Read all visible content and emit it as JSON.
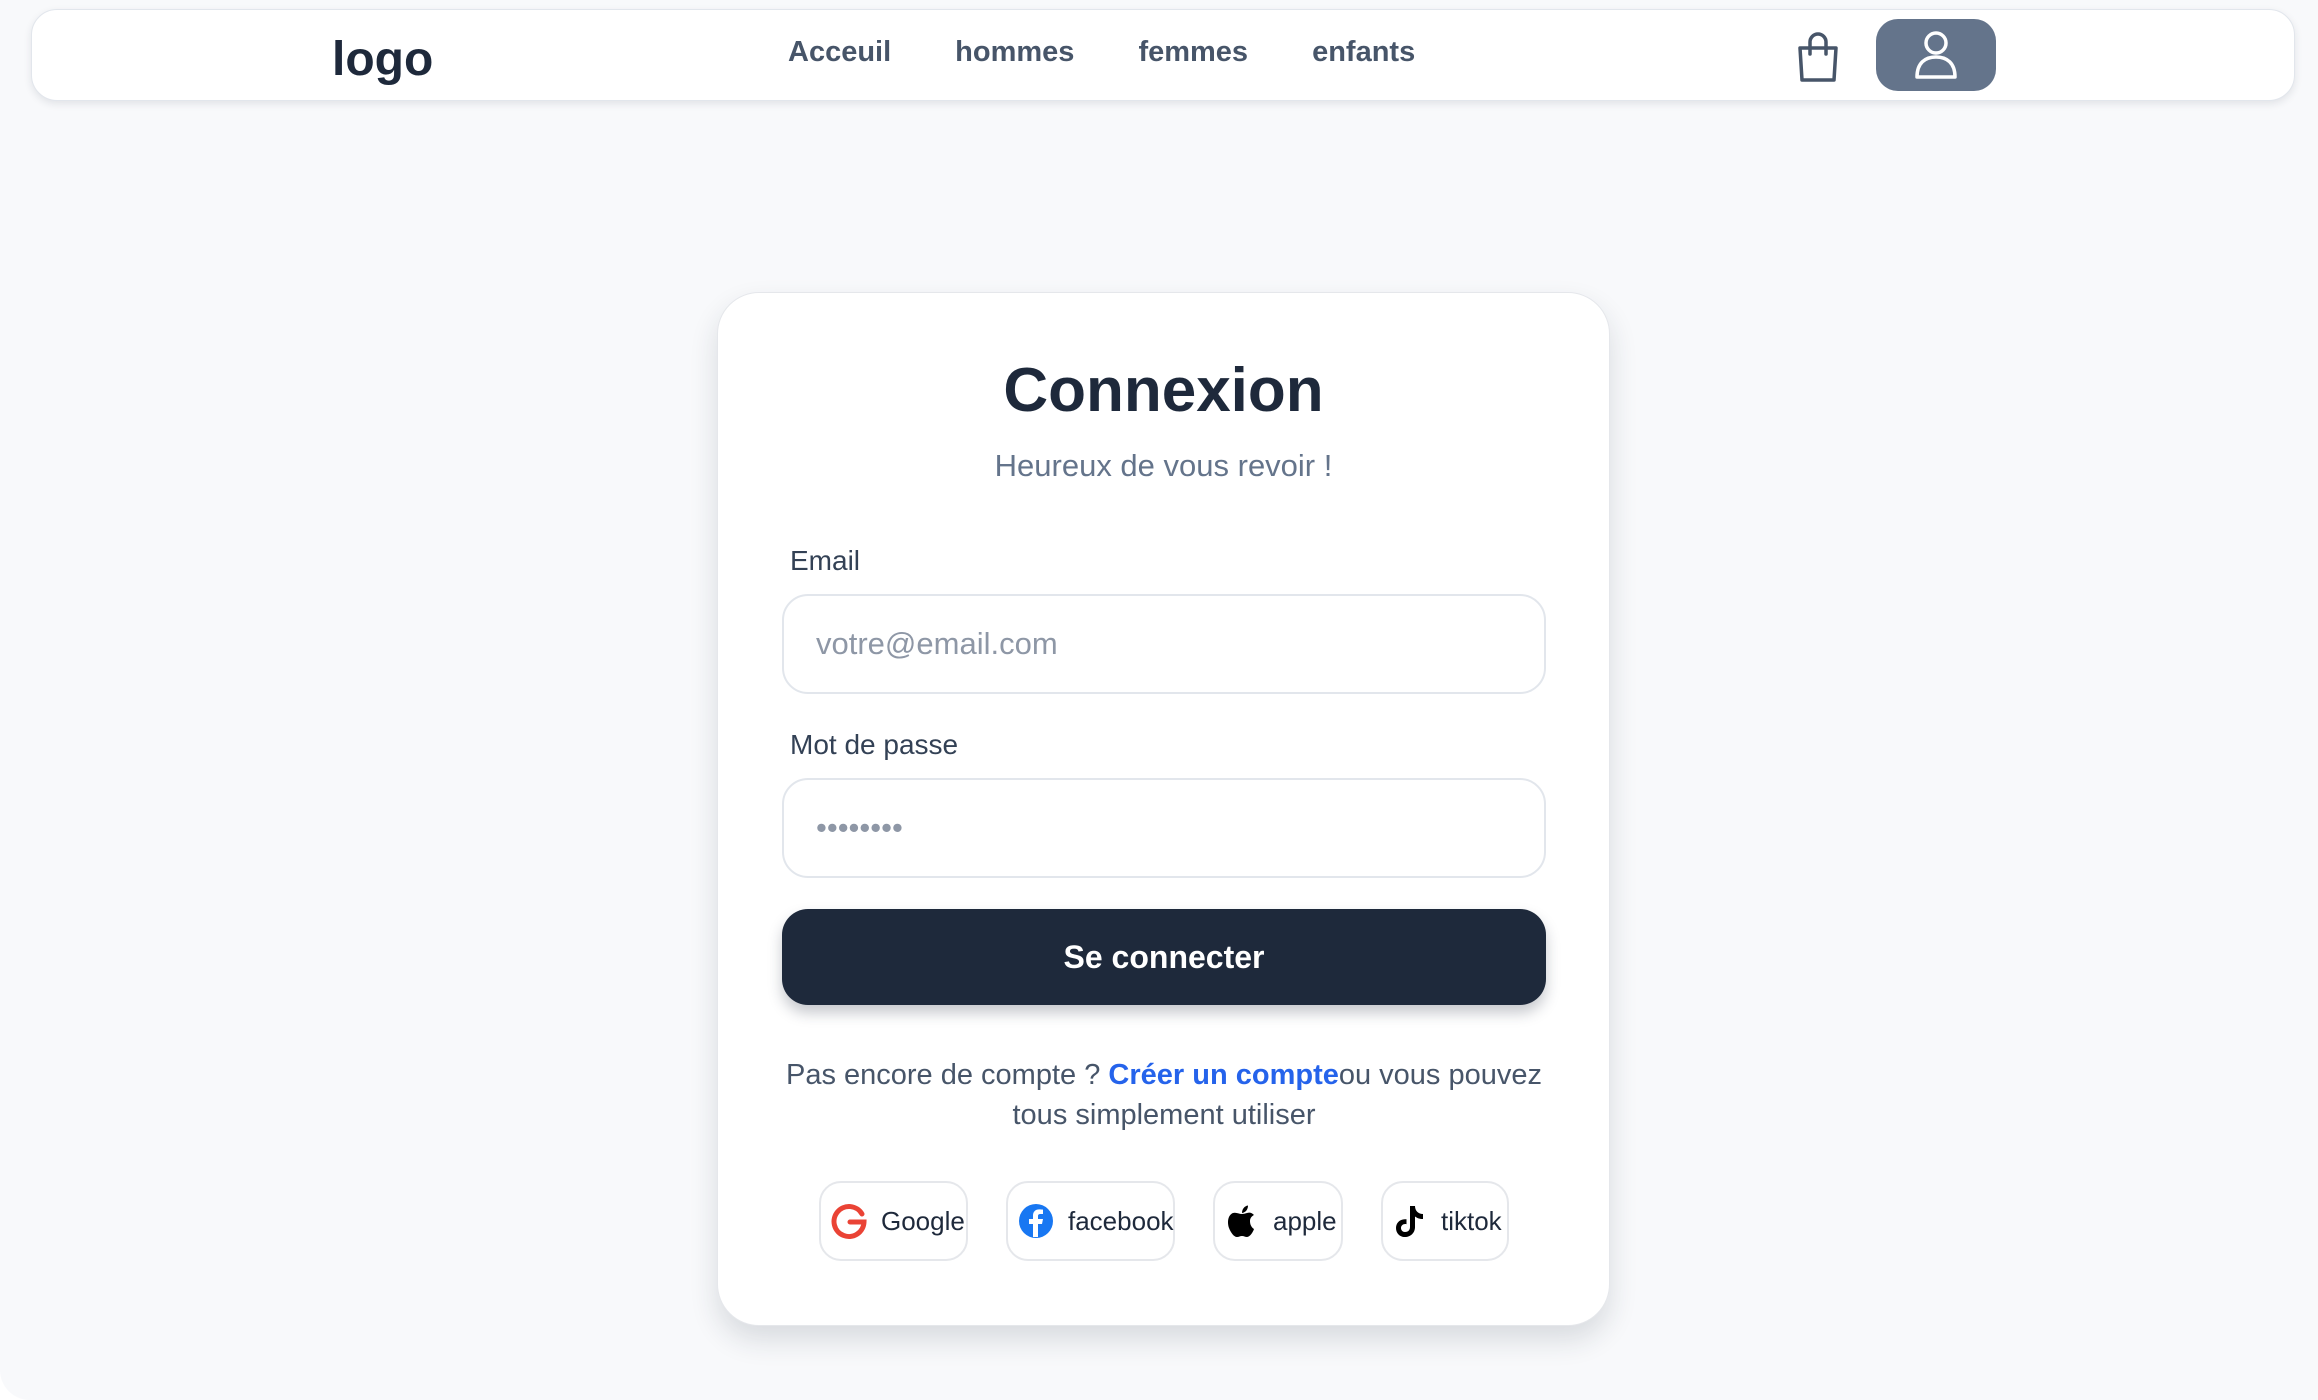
{
  "header": {
    "logo": "logo",
    "nav": [
      "Acceuil",
      "hommes",
      "femmes",
      "enfants"
    ],
    "icons": {
      "cart": "shopping-bag-icon",
      "user": "user-icon"
    },
    "colors": {
      "user_button_bg": "#64748b",
      "text": "#475569"
    }
  },
  "login": {
    "title": "Connexion",
    "subtitle": "Heureux de vous revoir !",
    "email_label": "Email",
    "email_placeholder": "votre@email.com",
    "password_label": "Mot de passe",
    "password_placeholder": "••••••••",
    "submit_label": "Se connecter",
    "signup_prefix": "Pas encore de compte ? ",
    "signup_link": "Créer un compte",
    "signup_suffix": "ou vous pouvez tous simplement utiliser",
    "colors": {
      "primary": "#1e293b",
      "link": "#2563eb",
      "muted": "#64748b"
    }
  },
  "social": [
    {
      "label": "Google",
      "icon": "google-icon",
      "color": "#ea4335"
    },
    {
      "label": "facebook",
      "icon": "facebook-icon",
      "color": "#1877f2"
    },
    {
      "label": "apple",
      "icon": "apple-icon",
      "color": "#000000"
    },
    {
      "label": "tiktok",
      "icon": "tiktok-icon",
      "color": "#000000"
    }
  ]
}
